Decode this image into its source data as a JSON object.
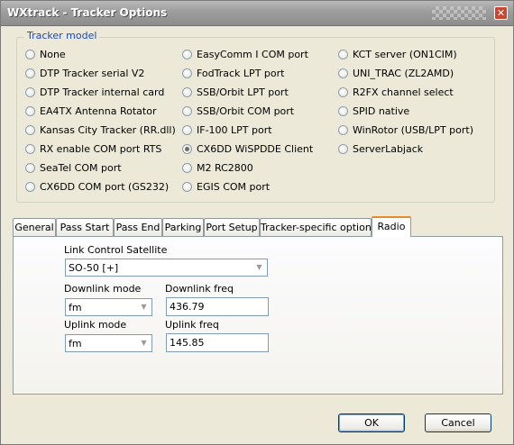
{
  "window": {
    "title": "WXtrack - Tracker Options",
    "close_icon": "close-icon"
  },
  "tracker_model": {
    "label": "Tracker model",
    "selected": "CX6DD WiSPDDE Client",
    "col1": [
      "None",
      "DTP Tracker serial V2",
      "DTP Tracker internal card",
      "EA4TX Antenna Rotator",
      "Kansas City Tracker (RR.dll)",
      "RX enable COM port RTS",
      "SeaTel COM port",
      "CX6DD COM port (GS232)"
    ],
    "col2": [
      "EasyComm I COM port",
      "FodTrack LPT port",
      "SSB/Orbit LPT port",
      "SSB/Orbit COM port",
      "IF-100 LPT port",
      "CX6DD WiSPDDE Client",
      "M2 RC2800",
      "EGIS COM port"
    ],
    "col3": [
      "KCT server (ON1CIM)",
      "UNI_TRAC (ZL2AMD)",
      "R2FX channel select",
      "SPID native",
      "WinRotor (USB/LPT port)",
      "ServerLabjack"
    ]
  },
  "tabs": [
    "General",
    "Pass Start",
    "Pass End",
    "Parking",
    "Port Setup",
    "Tracker-specific options",
    "Radio"
  ],
  "active_tab": "Radio",
  "radio": {
    "link_label": "Link Control Satellite",
    "link_value": "SO-50 [+]",
    "downlink_mode_label": "Downlink mode",
    "downlink_mode_value": "fm",
    "downlink_freq_label": "Downlink freq",
    "downlink_freq_value": "436.79",
    "uplink_mode_label": "Uplink mode",
    "uplink_mode_value": "fm",
    "uplink_freq_label": "Uplink freq",
    "uplink_freq_value": "145.85"
  },
  "buttons": {
    "ok": "OK",
    "cancel": "Cancel"
  }
}
